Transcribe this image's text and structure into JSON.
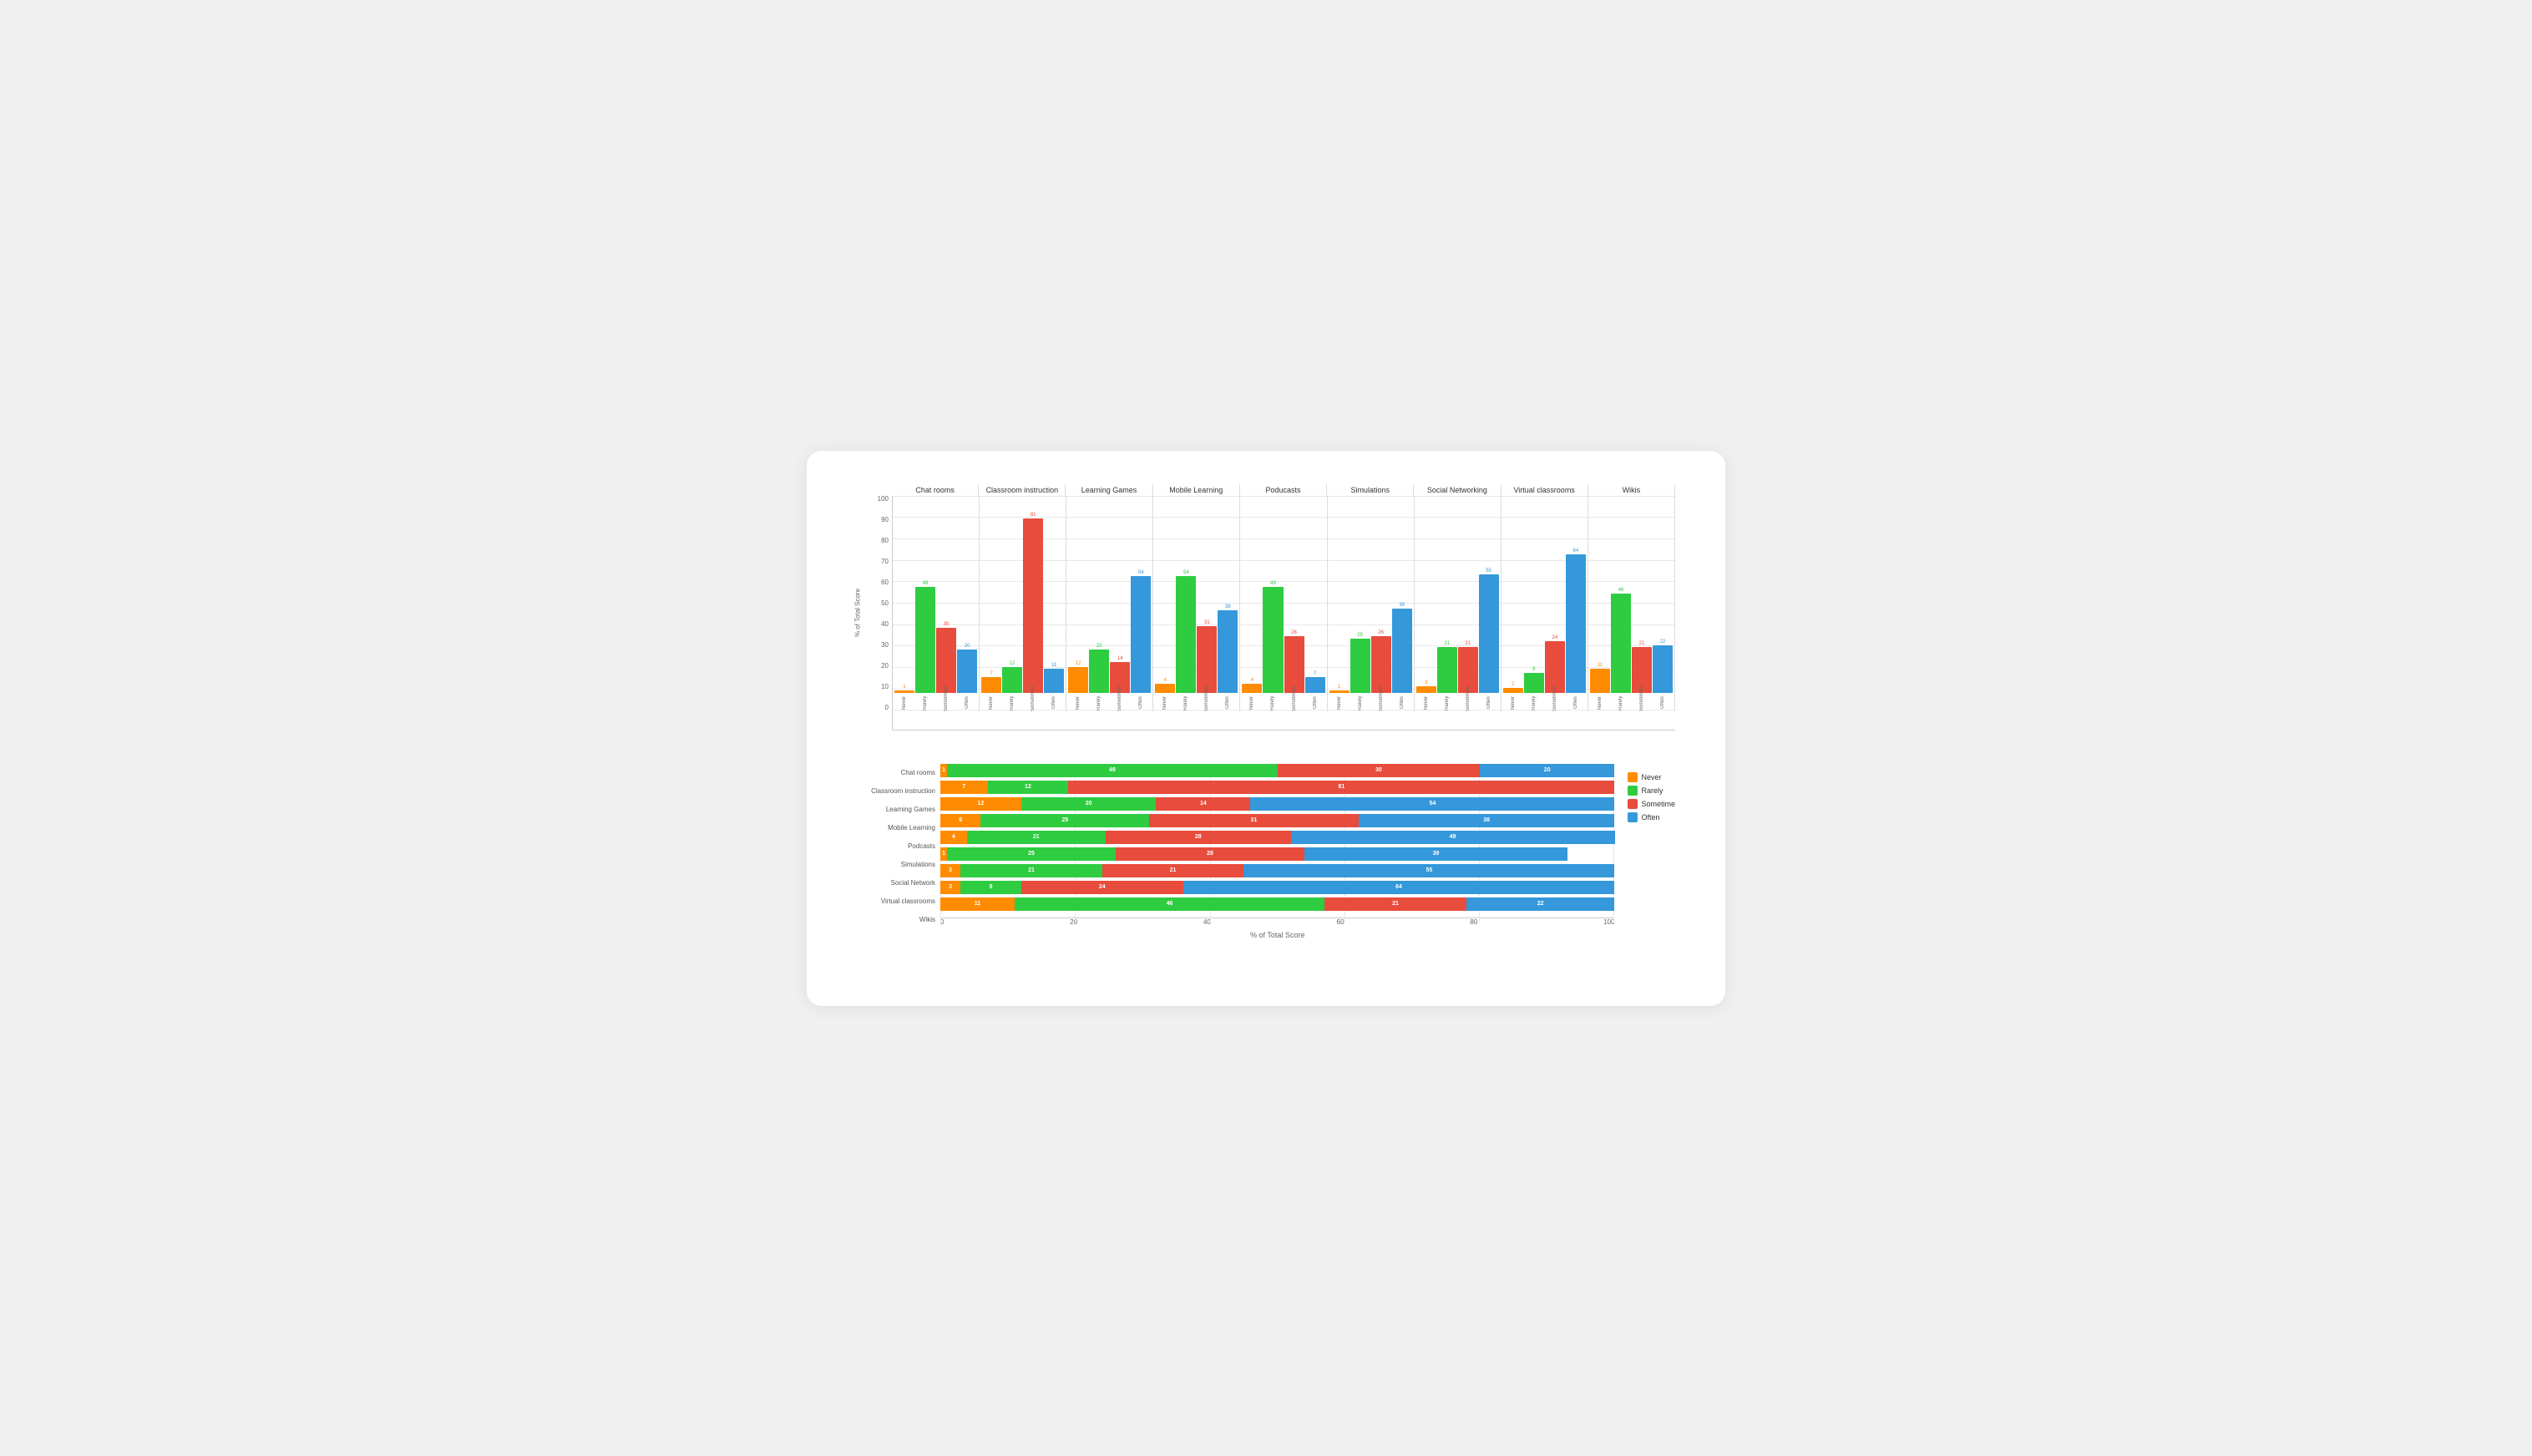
{
  "colors": {
    "never": "#FF8C00",
    "rarely": "#2ecc40",
    "sometime": "#e74c3c",
    "often": "#3498db"
  },
  "grouped": {
    "yLabel": "% of Total Score",
    "yTicks": [
      0,
      10,
      20,
      30,
      40,
      50,
      60,
      70,
      80,
      90,
      100
    ],
    "groups": [
      {
        "label": "Chat rooms",
        "bars": [
          {
            "sublabel": "Never",
            "value": 1,
            "color": "#FF8C00"
          },
          {
            "sublabel": "Rarely",
            "value": 49,
            "color": "#2ecc40"
          },
          {
            "sublabel": "Sometimes",
            "value": 30,
            "color": "#e74c3c"
          },
          {
            "sublabel": "Often",
            "value": 20,
            "color": "#3498db"
          }
        ]
      },
      {
        "label": "Classroom instruction",
        "bars": [
          {
            "sublabel": "Never",
            "value": 7,
            "color": "#FF8C00"
          },
          {
            "sublabel": "Rarely",
            "value": 12,
            "color": "#2ecc40"
          },
          {
            "sublabel": "Sometimes",
            "value": 81,
            "color": "#e74c3c"
          },
          {
            "sublabel": "Often",
            "value": 11,
            "color": "#3498db"
          }
        ]
      },
      {
        "label": "Learning Games",
        "bars": [
          {
            "sublabel": "Never",
            "value": 12,
            "color": "#FF8C00"
          },
          {
            "sublabel": "Rarely",
            "value": 20,
            "color": "#2ecc40"
          },
          {
            "sublabel": "Sometimes",
            "value": 14,
            "color": "#e74c3c"
          },
          {
            "sublabel": "Often",
            "value": 54,
            "color": "#3498db"
          }
        ]
      },
      {
        "label": "Mobile Learning",
        "bars": [
          {
            "sublabel": "Never",
            "value": 4,
            "color": "#FF8C00"
          },
          {
            "sublabel": "Rarely",
            "value": 54,
            "color": "#2ecc40"
          },
          {
            "sublabel": "Sometimes",
            "value": 31,
            "color": "#e74c3c"
          },
          {
            "sublabel": "Often",
            "value": 38,
            "color": "#3498db"
          }
        ]
      },
      {
        "label": "Poducasts",
        "bars": [
          {
            "sublabel": "Never",
            "value": 4,
            "color": "#FF8C00"
          },
          {
            "sublabel": "Rarely",
            "value": 49,
            "color": "#2ecc40"
          },
          {
            "sublabel": "Sometimes",
            "value": 26,
            "color": "#e74c3c"
          },
          {
            "sublabel": "Often",
            "value": 7,
            "color": "#3498db"
          }
        ]
      },
      {
        "label": "Simulations",
        "bars": [
          {
            "sublabel": "Never",
            "value": 1,
            "color": "#FF8C00"
          },
          {
            "sublabel": "Rarely",
            "value": 25,
            "color": "#2ecc40"
          },
          {
            "sublabel": "Sometimes",
            "value": 26,
            "color": "#e74c3c"
          },
          {
            "sublabel": "Often",
            "value": 39,
            "color": "#3498db"
          }
        ]
      },
      {
        "label": "Social Networking",
        "bars": [
          {
            "sublabel": "Never",
            "value": 3,
            "color": "#FF8C00"
          },
          {
            "sublabel": "Rarely",
            "value": 21,
            "color": "#2ecc40"
          },
          {
            "sublabel": "Sometimes",
            "value": 21,
            "color": "#e74c3c"
          },
          {
            "sublabel": "Often",
            "value": 55,
            "color": "#3498db"
          }
        ]
      },
      {
        "label": "Virtual classrooms",
        "bars": [
          {
            "sublabel": "Never",
            "value": 2,
            "color": "#FF8C00"
          },
          {
            "sublabel": "Rarely",
            "value": 9,
            "color": "#2ecc40"
          },
          {
            "sublabel": "Sometimes",
            "value": 24,
            "color": "#e74c3c"
          },
          {
            "sublabel": "Often",
            "value": 64,
            "color": "#3498db"
          }
        ]
      },
      {
        "label": "Wikis",
        "bars": [
          {
            "sublabel": "Never",
            "value": 11,
            "color": "#FF8C00"
          },
          {
            "sublabel": "Rarely",
            "value": 46,
            "color": "#2ecc40"
          },
          {
            "sublabel": "Sometimes",
            "value": 21,
            "color": "#e74c3c"
          },
          {
            "sublabel": "Often",
            "value": 22,
            "color": "#3498db"
          }
        ]
      }
    ]
  },
  "stacked": {
    "xLabel": "% of Total Score",
    "xTicks": [
      0,
      20,
      40,
      60,
      80,
      100
    ],
    "rows": [
      {
        "label": "Chat rooms",
        "never": 1,
        "rarely": 49,
        "sometime": 30,
        "often": 20
      },
      {
        "label": "Classroom instruction",
        "never": 7,
        "rarely": 12,
        "sometime": 81,
        "often": 0
      },
      {
        "label": "Learning Games",
        "never": 12,
        "rarely": 20,
        "sometime": 14,
        "often": 54
      },
      {
        "label": "Mobile Learning",
        "never": 6,
        "rarely": 25,
        "sometime": 31,
        "often": 38
      },
      {
        "label": "Podcasts",
        "never": 4,
        "rarely": 21,
        "sometime": 28,
        "often": 49
      },
      {
        "label": "Simulations",
        "never": 1,
        "rarely": 25,
        "sometime": 28,
        "often": 39
      },
      {
        "label": "Social Network",
        "never": 3,
        "rarely": 21,
        "sometime": 21,
        "often": 55
      },
      {
        "label": "Virtual classrooms",
        "never": 3,
        "rarely": 9,
        "sometime": 24,
        "often": 64
      },
      {
        "label": "Wikis",
        "never": 11,
        "rarely": 46,
        "sometime": 21,
        "often": 22
      }
    ],
    "legend": [
      {
        "label": "Never",
        "color": "#FF8C00"
      },
      {
        "label": "Rarely",
        "color": "#2ecc40"
      },
      {
        "label": "Sometime",
        "color": "#e74c3c"
      },
      {
        "label": "Often",
        "color": "#3498db"
      }
    ]
  }
}
